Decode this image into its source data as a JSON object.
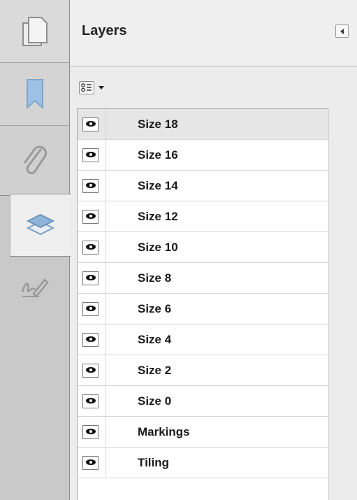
{
  "panel": {
    "title": "Layers"
  },
  "navigation": {
    "tools": [
      {
        "name": "pages",
        "icon": "pages-icon"
      },
      {
        "name": "bookmarks",
        "icon": "bookmark-icon"
      },
      {
        "name": "attachments",
        "icon": "paperclip-icon"
      },
      {
        "name": "layers",
        "icon": "layers-icon",
        "selected": true
      },
      {
        "name": "signatures",
        "icon": "signature-icon"
      }
    ]
  },
  "layers": [
    {
      "label": "Size 18",
      "visible": true,
      "selected": true
    },
    {
      "label": "Size 16",
      "visible": true
    },
    {
      "label": "Size 14",
      "visible": true
    },
    {
      "label": "Size 12",
      "visible": true
    },
    {
      "label": "Size 10",
      "visible": true
    },
    {
      "label": "Size 8",
      "visible": true
    },
    {
      "label": "Size 6",
      "visible": true
    },
    {
      "label": "Size 4",
      "visible": true
    },
    {
      "label": "Size 2",
      "visible": true
    },
    {
      "label": "Size 0",
      "visible": true
    },
    {
      "label": "Markings",
      "visible": true
    },
    {
      "label": "Tiling",
      "visible": true
    }
  ],
  "colors": {
    "selection": "#e6e6e6",
    "accent_blue": "#8cb4d9"
  }
}
